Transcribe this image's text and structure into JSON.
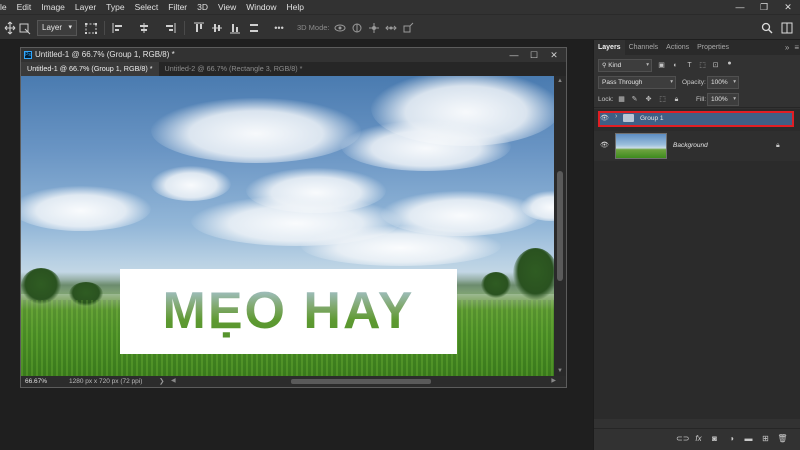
{
  "menubar": {
    "items": [
      "le",
      "Edit",
      "Image",
      "Layer",
      "Type",
      "Select",
      "Filter",
      "3D",
      "View",
      "Window",
      "Help"
    ],
    "controls": [
      "—",
      "❐",
      "✕"
    ]
  },
  "optionsbar": {
    "auto_select_target": "Layer",
    "mode_3d_label": "3D Mode:",
    "more_label": "•••"
  },
  "document": {
    "title": "Untitled-1 @ 66.7% (Group 1, RGB/8) *",
    "tabs": [
      {
        "label": "Untitled-1 @ 66.7% (Group 1, RGB/8) *",
        "active": true
      },
      {
        "label": "Untitled-2 @ 66.7% (Rectangle 3, RGB/8) *",
        "active": false
      }
    ],
    "canvas_text": "MẸO HAY",
    "zoom": "66.67%",
    "doc_size": "1280 px x 720 px (72 ppi)",
    "winctl": [
      "—",
      "☐",
      "✕"
    ],
    "ps_logo": "Ps"
  },
  "panel": {
    "tabs": [
      "Layers",
      "Channels",
      "Actions",
      "Properties"
    ],
    "active_tab": "Layers",
    "filter_kind": "Kind",
    "blend_mode": "Pass Through",
    "opacity_label": "Opacity:",
    "opacity_value": "100%",
    "lock_label": "Lock:",
    "fill_label": "Fill:",
    "fill_value": "100%",
    "layers": [
      {
        "name": "Group 1",
        "type": "group",
        "visible": true,
        "selected": true
      },
      {
        "name": "Background",
        "type": "pixel",
        "visible": true,
        "locked": true
      }
    ],
    "footer_icons": [
      "link-icon",
      "fx-icon",
      "mask-icon",
      "adjustment-icon",
      "folder-icon",
      "new-layer-icon",
      "trash-icon"
    ]
  },
  "colors": {
    "selection_outline": "#e01e24",
    "selected_layer_bg": "#3f5f85",
    "accent": "#31a8ff"
  }
}
